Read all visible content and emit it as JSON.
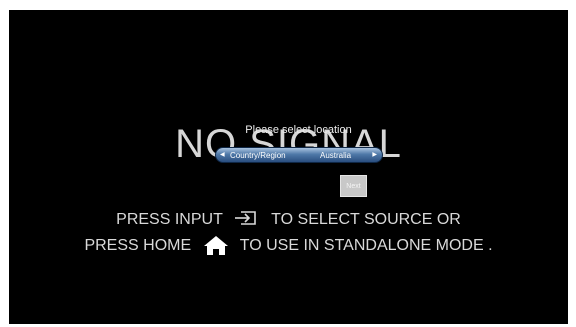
{
  "background_text": "NO SIGNAL",
  "dialog": {
    "title": "Please select location",
    "selector": {
      "label": "Country/Region",
      "value": "Australia"
    },
    "next_label": "Next"
  },
  "instructions": {
    "line1_before": "PRESS INPUT",
    "line1_after": "TO SELECT SOURCE OR",
    "line2_before": "PRESS HOME",
    "line2_after": "TO USE IN STANDALONE MODE ."
  },
  "icons": {
    "input": "input-source-icon",
    "home": "home-icon"
  },
  "colors": {
    "selector_top": "#a9c3e0",
    "selector_bottom": "#2a4e7f",
    "next_button": "#c8c8c8"
  }
}
